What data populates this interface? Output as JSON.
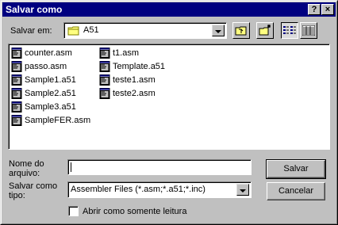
{
  "window": {
    "title": "Salvar como",
    "help_button": "?",
    "close_button": "×"
  },
  "location": {
    "label": "Salvar em:",
    "value": "A51"
  },
  "toolbar": {
    "up_folder": "up-one-level-icon",
    "new_folder": "new-folder-icon",
    "list_view": "list-view-icon",
    "details_view": "details-view-icon"
  },
  "files": {
    "column1": [
      "counter.asm",
      "passo.asm",
      "Sample1.a51",
      "Sample2.a51",
      "Sample3.a51",
      "SampleFER.asm"
    ],
    "column2": [
      "t1.asm",
      "Template.a51",
      "teste1.asm",
      "teste2.asm"
    ]
  },
  "filename": {
    "label_line1": "Nome do",
    "label_line2": "arquivo:",
    "value": ""
  },
  "filetype": {
    "label_line1": "Salvar como",
    "label_line2": "tipo:",
    "value": "Assembler Files (*.asm;*.a51;*.inc)"
  },
  "buttons": {
    "save": "Salvar",
    "cancel": "Cancelar"
  },
  "readonly": {
    "label": "Abrir como somente leitura",
    "checked": false
  }
}
